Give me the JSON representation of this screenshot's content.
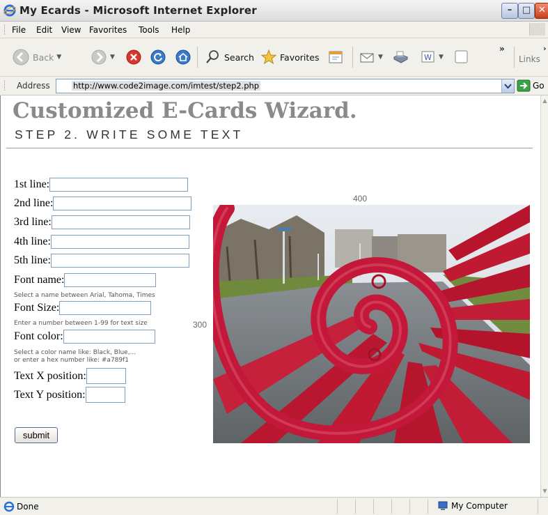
{
  "window": {
    "title": "My Ecards - Microsoft Internet Explorer"
  },
  "menu": [
    "File",
    "Edit",
    "View",
    "Favorites",
    "Tools",
    "Help"
  ],
  "toolbar": {
    "back": "Back",
    "search": "Search",
    "favorites": "Favorites",
    "overflow": "»",
    "links": "Links"
  },
  "address": {
    "label": "Address",
    "url": "http://www.code2image.com/imtest/step2.php",
    "go": "Go"
  },
  "page": {
    "title": "Customized E-Cards Wizard.",
    "subtitle": "STEP 2. WRITE SOME TEXT",
    "fields": {
      "line1": "1st line:",
      "line2": "2nd line:",
      "line3": "3rd line:",
      "line4": "4th line:",
      "line5": "5th line:",
      "font_name": "Font name:",
      "font_name_hint": "Select a name between Arial, Tahoma, Times",
      "font_size": "Font Size:",
      "font_size_hint": "Enter a number between 1-99 for text size",
      "font_color": "Font color:",
      "font_color_hint_1": "Select a color name like: Black, Blue,...",
      "font_color_hint_2": "or enter a hex number like: #a789f1",
      "text_x": "Text X position:",
      "text_y": "Text Y position:"
    },
    "submit": "submit",
    "image_width_label": "400",
    "image_height_label": "300"
  },
  "status": {
    "text": "Done",
    "zone": "My Computer"
  }
}
